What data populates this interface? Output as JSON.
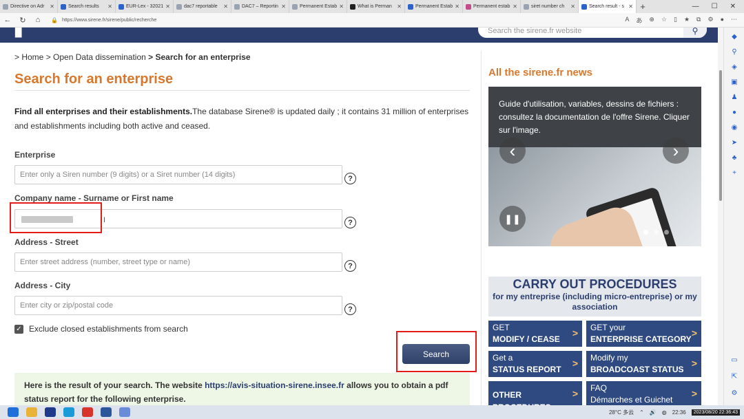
{
  "browser": {
    "tabs": [
      {
        "label": "Directive on Adr",
        "color": "#9aa3b1"
      },
      {
        "label": "Search results",
        "color": "#2c62c9"
      },
      {
        "label": "EUR-Lex - 32021",
        "color": "#2c62c9"
      },
      {
        "label": "dac7 reportable",
        "color": "#9aa3b1"
      },
      {
        "label": "DAC7 – Reportin",
        "color": "#9aa3b1"
      },
      {
        "label": "Permanent Estab",
        "color": "#9aa3b1"
      },
      {
        "label": "What is Perman",
        "color": "#222222"
      },
      {
        "label": "Permanent Estab",
        "color": "#2c62c9"
      },
      {
        "label": "Permanent estab",
        "color": "#c24d8a"
      },
      {
        "label": "siret number ch",
        "color": "#9aa3b1"
      },
      {
        "label": "Search result - s",
        "color": "#2c62c9",
        "active": true
      }
    ],
    "url": "https://www.sirene.fr/sirene/public/recherche"
  },
  "site": {
    "search_placeholder": "Search the sirene.fr website"
  },
  "breadcrumb": {
    "home": "> Home",
    "mid": "> Open Data dissemination",
    "current": "> Search for an enterprise"
  },
  "main": {
    "title": "Search for an enterprise",
    "intro_bold": "Find all enterprises and their establishments.",
    "intro_rest": "The database Sirene® is updated daily ; it contains 31 million of enterprises and establishments including both active and ceased."
  },
  "form": {
    "enterprise_label": "Enterprise",
    "enterprise_placeholder": "Enter only a Siren number (9 digits) or a Siret number (14 digits)",
    "company_label": "Company name - Surname or First name",
    "street_label": "Address - Street",
    "street_placeholder": "Enter street address (number, street type or name)",
    "city_label": "Address - City",
    "city_placeholder": "Enter city or zip/postal code",
    "help_glyph": "?",
    "exclude_closed_label": "Exclude closed establishments from search",
    "exclude_closed_checked": true,
    "search_button": "Search"
  },
  "result": {
    "text_before": "Here is the result of your search. The website ",
    "link": "https://avis-situation-sirene.insee.fr",
    "text_after": " allows you to obtain a pdf status report for the following enterprise."
  },
  "sidebar": {
    "news_title": "All the sirene.fr news",
    "carousel_text": "Guide d'utilisation, variables, dessins de fichiers : consultez la documentation de l'offre Sirene. Cliquer sur l'image.",
    "procedures_title": "CARRY OUT PROCEDURES",
    "procedures_sub": "for my entreprise (including micro-entreprise) or my association",
    "buttons": [
      {
        "l1": "GET",
        "l2": "MODIFY / CEASE"
      },
      {
        "l1": "GET your",
        "l2": "ENTERPRISE CATEGORY"
      },
      {
        "l1": "Get a",
        "l2": "STATUS REPORT"
      },
      {
        "l1": "Modify my",
        "l2": "BROADCOAST STATUS"
      },
      {
        "l1": "",
        "l2": "OTHER PROCEDURES"
      },
      {
        "l1": "FAQ",
        "l2": "Démarches et Guichet Unique"
      }
    ]
  },
  "taskbar": {
    "weather": "28°C 多云",
    "time": "22:36",
    "datetime": "2023/08/20 22:36:43"
  }
}
